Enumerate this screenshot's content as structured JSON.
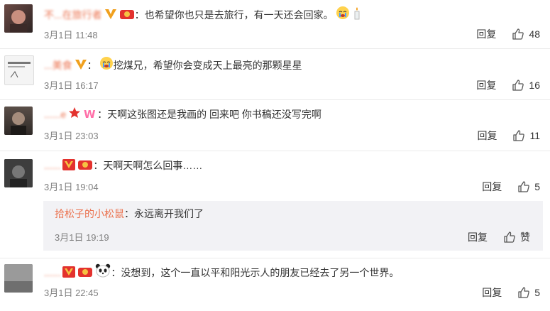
{
  "comments": [
    {
      "username": "不...在旅行者",
      "text": "也希望你也只是去旅行，有一天还会回家。",
      "date": "3月1日 11:48",
      "reply_label": "回复",
      "likes": "48"
    },
    {
      "username": "...美食",
      "text": "挖煤兄，希望你会变成天上最亮的那颗星星",
      "date": "3月1日 16:17",
      "reply_label": "回复",
      "likes": "16"
    },
    {
      "username": "......e",
      "text": "天啊这张图还是我画的 回来吧 你书稿还没写完啊",
      "date": "3月1日 23:03",
      "reply_label": "回复",
      "likes": "11"
    },
    {
      "username": "......",
      "text": "天啊天啊怎么回事……",
      "date": "3月1日 19:04",
      "reply_label": "回复",
      "likes": "5"
    },
    {
      "username": "......",
      "text": "没想到，这个一直以平和阳光示人的朋友已经去了另一个世界。",
      "date": "3月1日 22:45",
      "reply_label": "回复",
      "likes": "5"
    }
  ],
  "nested_reply": {
    "username": "拾松子的小松鼠",
    "text": "永远离开我们了",
    "date": "3月1日 19:19",
    "reply_label": "回复",
    "like_label": "赞"
  },
  "colors": {
    "username": "#eb7350",
    "badge_gold": "#f0a01e",
    "badge_red": "#e3322e",
    "reply_bg": "#f2f2f5"
  },
  "icons": [
    "thumbs-up-icon",
    "vip-badge-icon",
    "crying-emoji-icon",
    "panda-emoji-icon"
  ]
}
